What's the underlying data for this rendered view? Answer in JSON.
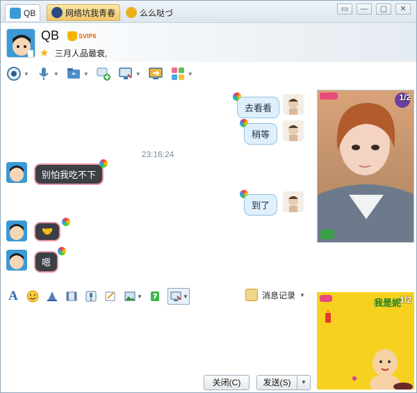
{
  "tabs": [
    {
      "label": "QB",
      "active": true
    },
    {
      "label": "网络坑我青春",
      "highlighted": true
    },
    {
      "label": "么么哒づ"
    }
  ],
  "window_controls": {
    "pin": "▭",
    "minimize": "—",
    "maximize": "▢",
    "close": "✕"
  },
  "header": {
    "name": "QB",
    "vip_label": "SVIP6",
    "signature": "三月人品最衰,"
  },
  "actions": [
    {
      "icon": "camera-icon",
      "dropdown": true
    },
    {
      "icon": "microphone-icon",
      "dropdown": true
    },
    {
      "icon": "file-transfer-icon",
      "dropdown": true
    },
    {
      "icon": "new-discussion-icon",
      "dropdown": false
    },
    {
      "icon": "screen-share-icon",
      "dropdown": true
    },
    {
      "icon": "remote-assist-icon",
      "dropdown": false
    },
    {
      "icon": "apps-icon",
      "dropdown": true
    }
  ],
  "messages": {
    "timestamp": "23:16:24",
    "outgoing_1": "去看看",
    "outgoing_2": "稍等",
    "incoming_1": "别怕我吃不下",
    "outgoing_3": "到了",
    "incoming_2": "🤝",
    "incoming_3": "嗯"
  },
  "input_toolbar": {
    "history_label": "消息记录",
    "icons": [
      "font-icon",
      "emoji-icon",
      "magic-icon",
      "video-clip-icon",
      "voice-message-icon",
      "scribble-icon",
      "image-icon",
      "gift-icon",
      "screenshot-icon"
    ]
  },
  "footer": {
    "close_label": "关闭(C)",
    "send_label": "发送(S)"
  },
  "video_panel": {
    "page_indicator": "1/2"
  },
  "show_panel": {
    "title": "我是妮",
    "page_indicator": "1/2"
  },
  "colors": {
    "accent": "#3b9ad6",
    "outgoing_bubble": "#dff0fc",
    "incoming_bubble": "#3c3f44",
    "show_background": "#f7d11f"
  }
}
